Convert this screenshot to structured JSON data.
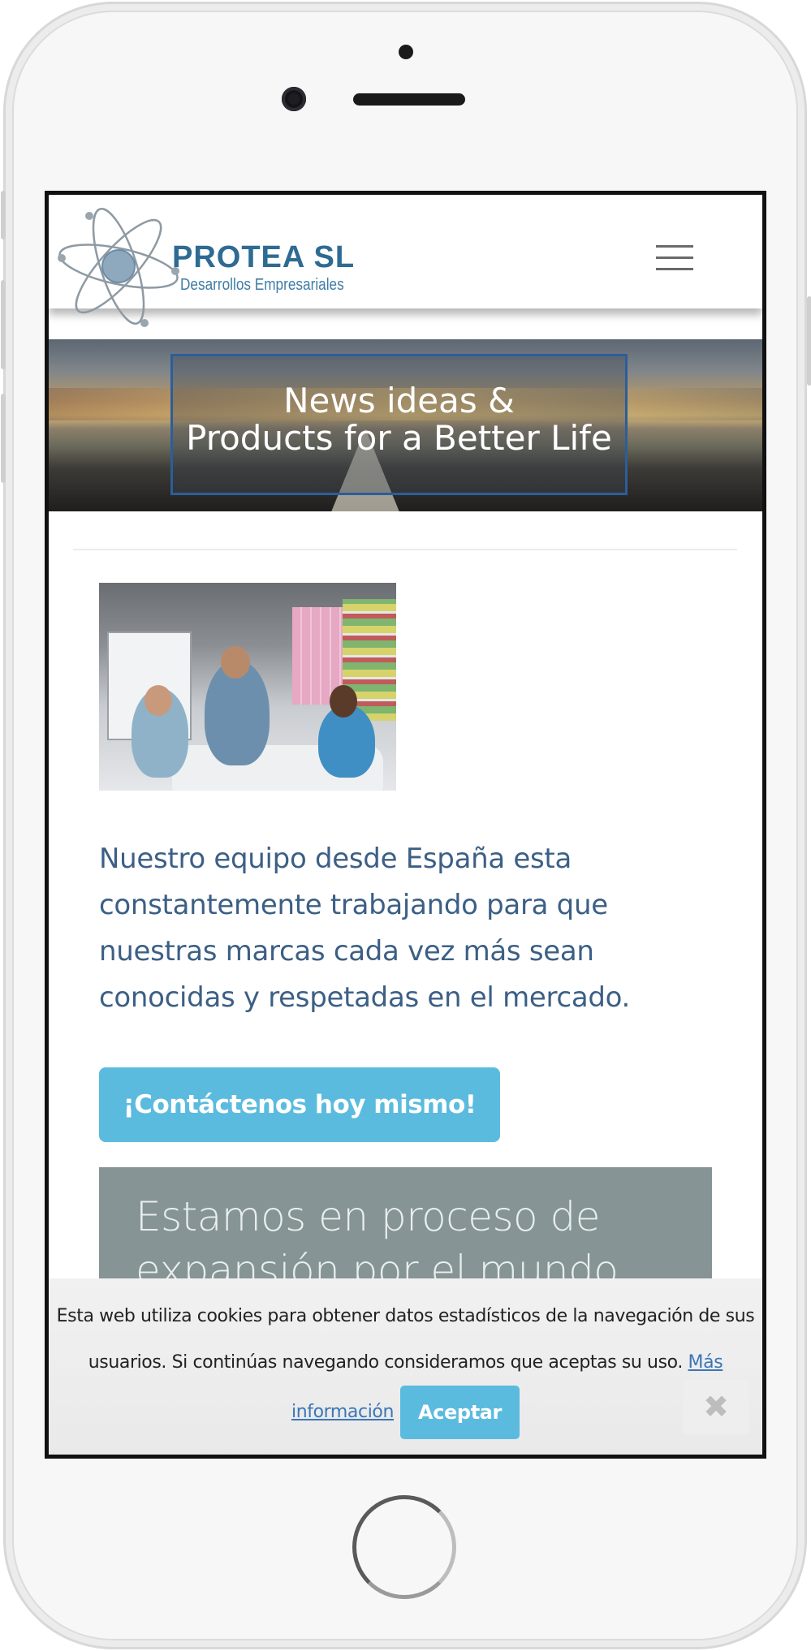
{
  "header": {
    "brand": "PROTEA SL",
    "tagline": "Desarrollos Empresariales",
    "menu_icon": "hamburger-menu-icon"
  },
  "banner": {
    "line1": "News ideas &",
    "line2": "Products for a Better Life"
  },
  "content": {
    "headline": "Nuestro equipo desde España esta constantemente trabajando para que nuestras marcas cada vez más sean conocidas y respetadas en el mercado.",
    "cta_label": "¡Contáctenos hoy mismo!",
    "expansion_text": "Estamos en proceso de expansión por el mundo"
  },
  "cookie_notice": {
    "line1": "Esta web utiliza cookies para obtener datos estadísticos de la navegación de sus",
    "line2": "usuarios. Si continúas navegando consideramos que aceptas su uso.",
    "more_info_part1": "Más",
    "more_info_part2": "información",
    "accept_label": "Aceptar",
    "close_icon": "✖"
  },
  "colors": {
    "brand_blue": "#2e6b93",
    "cta_blue": "#5bbbdf",
    "headline_blue": "#3c5f85",
    "gray_panel": "#869496"
  }
}
